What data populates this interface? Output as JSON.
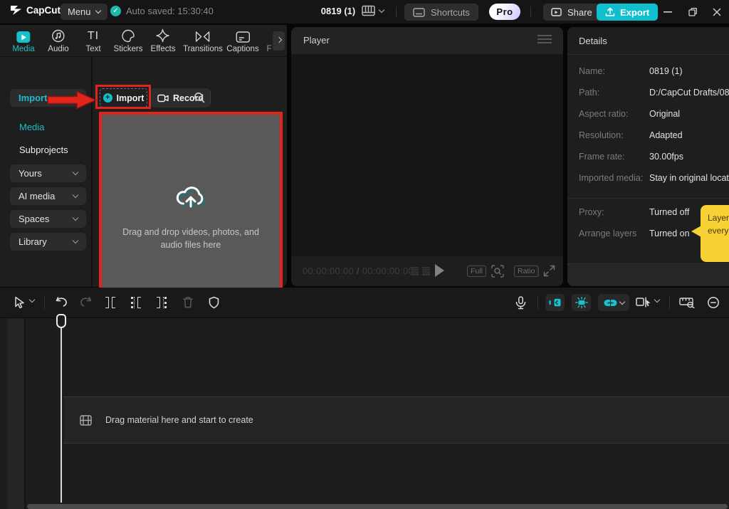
{
  "topbar": {
    "logo_text": "CapCut",
    "menu_label": "Menu",
    "autosave_text": "Auto saved: 15:30:40",
    "project_title": "0819 (1)",
    "shortcuts_label": "Shortcuts",
    "pro_label": "Pro",
    "share_label": "Share",
    "export_label": "Export"
  },
  "tabs": [
    {
      "label": "Media",
      "active": true
    },
    {
      "label": "Audio",
      "active": false
    },
    {
      "label": "Text",
      "active": false
    },
    {
      "label": "Stickers",
      "active": false
    },
    {
      "label": "Effects",
      "active": false
    },
    {
      "label": "Transitions",
      "active": false
    },
    {
      "label": "Captions",
      "active": false
    },
    {
      "label": "F",
      "active": false
    }
  ],
  "sidebar": {
    "import_label": "Import",
    "media_label": "Media",
    "subprojects_label": "Subprojects",
    "dropdowns": [
      {
        "label": "Yours"
      },
      {
        "label": "AI media"
      },
      {
        "label": "Spaces"
      },
      {
        "label": "Library"
      }
    ]
  },
  "media_panel": {
    "import_button_label": "Import",
    "record_button_label": "Record",
    "dropzone_text": "Drag and drop videos, photos, and audio files here"
  },
  "player": {
    "title": "Player",
    "timecode_current": "00:00:00:00",
    "timecode_separator": "/",
    "timecode_total": "00:00:00:00",
    "full_label": "Full",
    "ratio_label": "Ratio"
  },
  "details": {
    "title": "Details",
    "rows": [
      {
        "label": "Name:",
        "value": "0819 (1)"
      },
      {
        "label": "Path:",
        "value": "D:/CapCut Drafts/08"
      },
      {
        "label": "Aspect ratio:",
        "value": "Original"
      },
      {
        "label": "Resolution:",
        "value": "Adapted"
      },
      {
        "label": "Frame rate:",
        "value": "30.00fps"
      },
      {
        "label": "Imported media:",
        "value": "Stay in original locat"
      }
    ],
    "rows2": [
      {
        "label": "Proxy:",
        "value": "Turned off"
      },
      {
        "label": "Arrange layers",
        "value": "Turned on"
      }
    ],
    "tooltip": {
      "line1": "Layers o",
      "line2": "every n"
    }
  },
  "timeline": {
    "empty_track_text": "Drag material here and start to create"
  },
  "colors": {
    "accent_cyan": "#10bfcd",
    "annotation_red": "#e1251b",
    "tooltip_yellow": "#f6d234",
    "dropzone_gray": "#595959"
  }
}
